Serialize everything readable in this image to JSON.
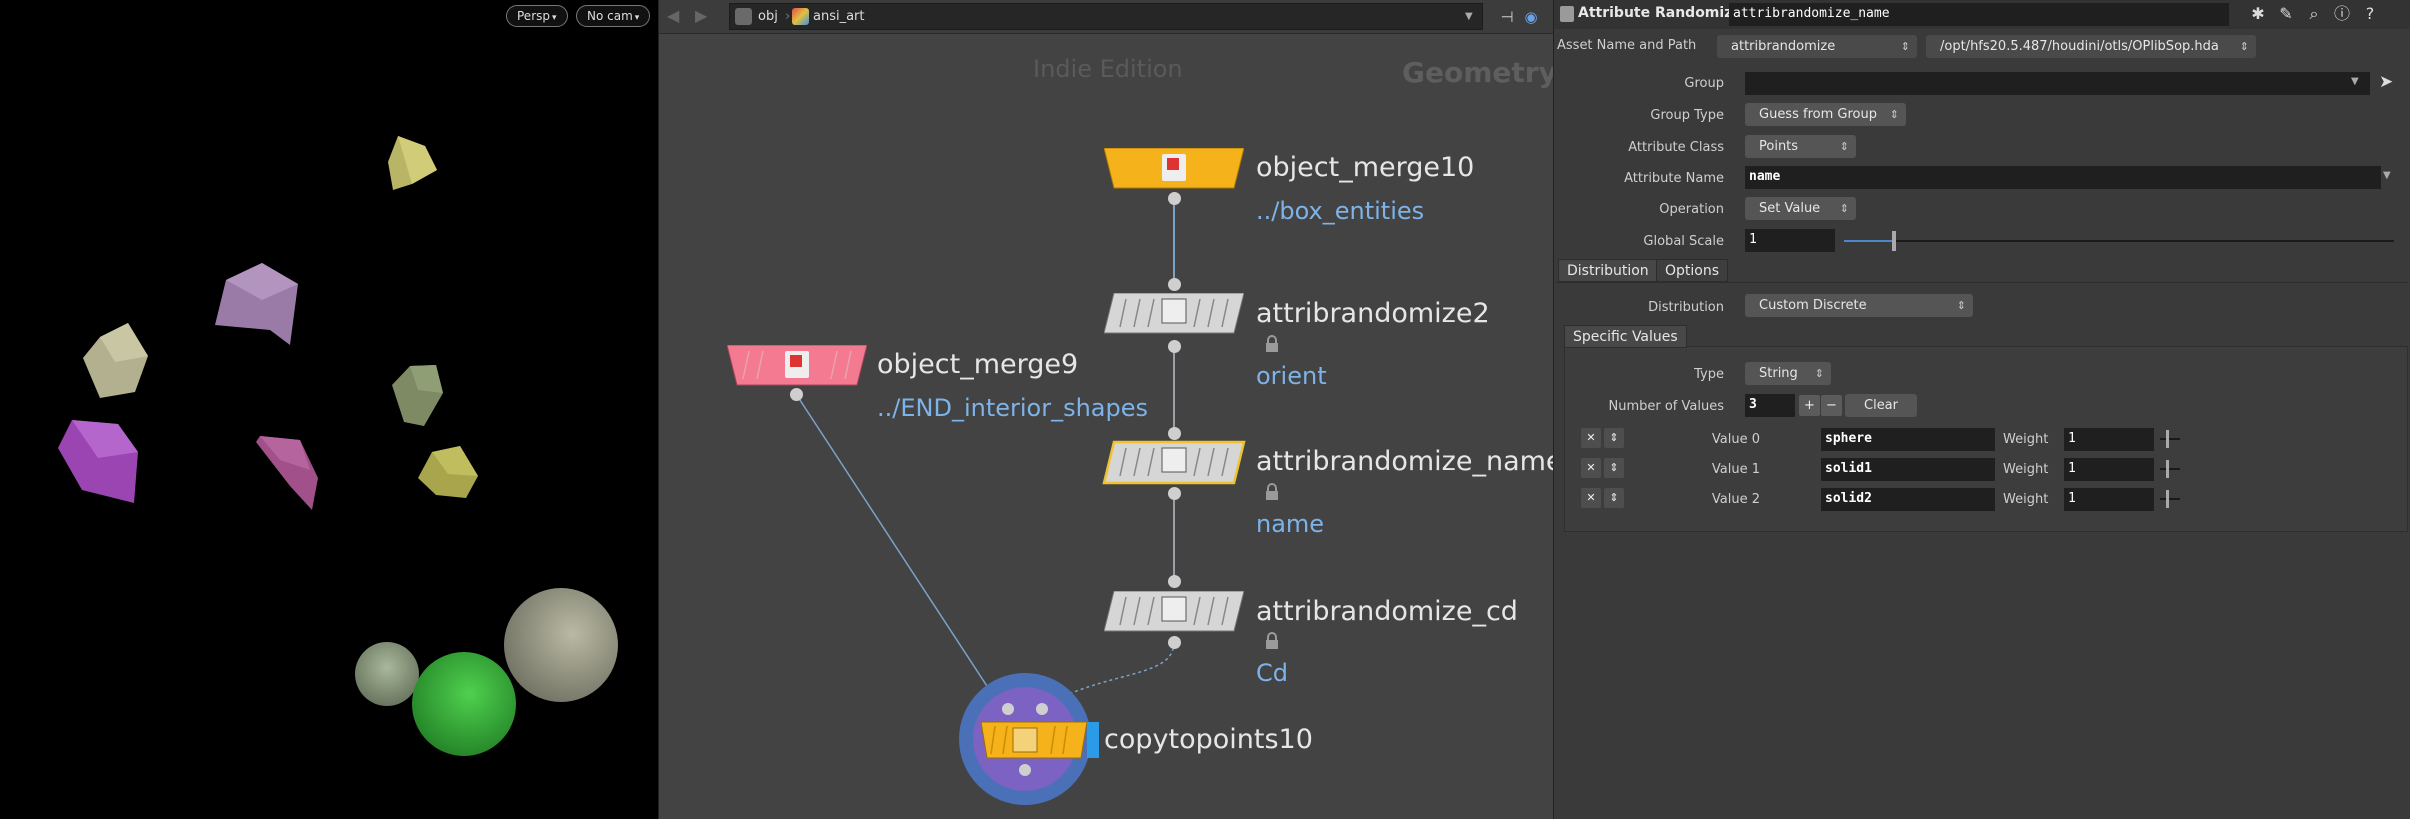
{
  "viewport": {
    "camera_view": "Persp",
    "camera": "No cam"
  },
  "network": {
    "path": {
      "root": "obj",
      "node": "ansi_art"
    },
    "watermark": "Indie Edition",
    "context": "Geometry",
    "nodes": [
      {
        "name": "object_merge10",
        "sub": "../box_entities"
      },
      {
        "name": "attribrandomize2",
        "sub": "orient"
      },
      {
        "name": "object_merge9",
        "sub": "../END_interior_shapes"
      },
      {
        "name": "attribrandomize_name",
        "sub": "name"
      },
      {
        "name": "attribrandomize_cd",
        "sub": "Cd"
      },
      {
        "name": "copytopoints10",
        "sub": ""
      }
    ]
  },
  "params": {
    "node_type": "Attribute Randomize",
    "node_name": "attribrandomize_name",
    "asset_label": "Asset Name and Path",
    "asset_name": "attribrandomize",
    "asset_path": "/opt/hfs20.5.487/houdini/otls/OPlibSop.hda",
    "group_label": "Group",
    "group_value": "",
    "group_type_label": "Group Type",
    "group_type": "Guess from Group",
    "attr_class_label": "Attribute Class",
    "attr_class": "Points",
    "attr_name_label": "Attribute Name",
    "attr_name": "name",
    "operation_label": "Operation",
    "operation": "Set Value",
    "global_scale_label": "Global Scale",
    "global_scale": "1",
    "global_scale_fraction": 0.09,
    "tabs": [
      "Distribution",
      "Options"
    ],
    "distribution_label": "Distribution",
    "distribution": "Custom Discrete",
    "specific_values_tab": "Specific Values",
    "type_label": "Type",
    "type": "String",
    "num_values_label": "Number of Values",
    "num_values": "3",
    "plus": "+",
    "minus": "−",
    "clear": "Clear",
    "weight_label": "Weight",
    "values": [
      {
        "label": "Value 0",
        "value": "sphere",
        "weight": "1"
      },
      {
        "label": "Value 1",
        "value": "solid1",
        "weight": "1"
      },
      {
        "label": "Value 2",
        "value": "solid2",
        "weight": "1"
      }
    ]
  }
}
